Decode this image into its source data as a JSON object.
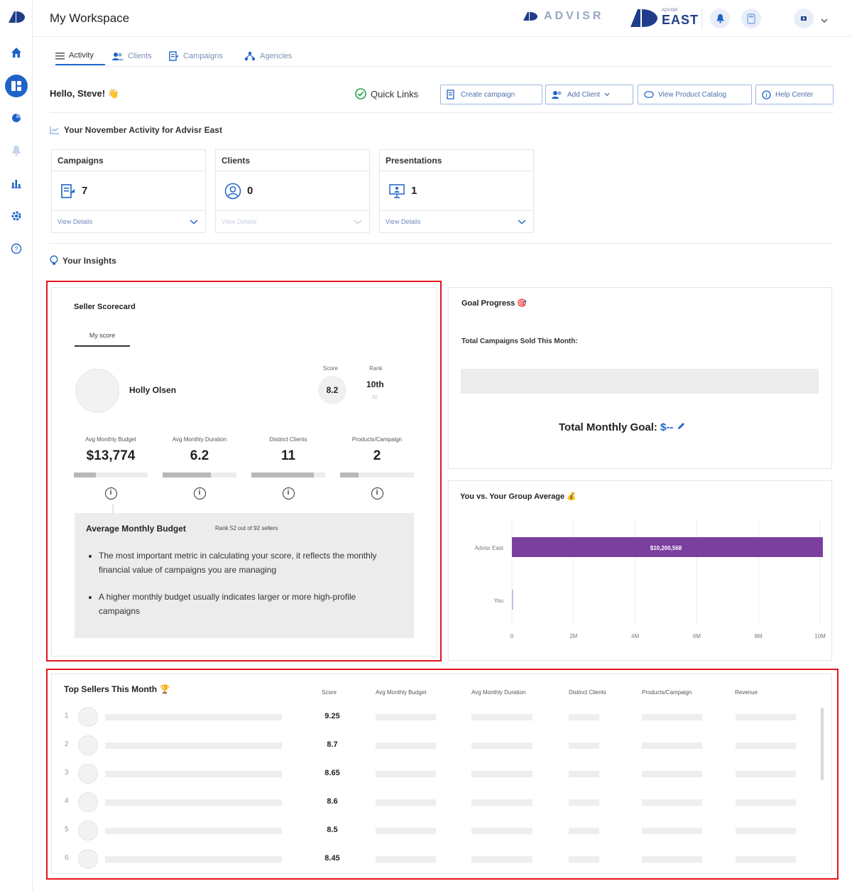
{
  "topbar": {
    "title": "My Workspace",
    "brand_primary": "ADVISR",
    "brand_secondary_small": "ADVISR",
    "brand_secondary": "EAST"
  },
  "sidebar": {
    "icons": [
      "logo-icon",
      "home-icon",
      "dashboard-icon",
      "pie-chart-icon",
      "bell-icon",
      "bar-chart-icon",
      "gear-icon",
      "help-icon"
    ]
  },
  "tabs": [
    {
      "label": "Activity",
      "active": true
    },
    {
      "label": "Clients",
      "active": false
    },
    {
      "label": "Campaigns",
      "active": false
    },
    {
      "label": "Agencies",
      "active": false
    }
  ],
  "greeting": "Hello, Steve! 👋",
  "quick_links": {
    "label": "Quick Links",
    "buttons": [
      "Create campaign",
      "Add Client",
      "View Product Catalog",
      "Help Center"
    ]
  },
  "activity": {
    "title": "Your November Activity for Advisr East",
    "cards": [
      {
        "title": "Campaigns",
        "value": "7",
        "link": "View Details",
        "enabled": true
      },
      {
        "title": "Clients",
        "value": "0",
        "link": "View Details",
        "enabled": false
      },
      {
        "title": "Presentations",
        "value": "1",
        "link": "View Details",
        "enabled": true
      }
    ]
  },
  "insights": {
    "title": "Your Insights"
  },
  "scorecard": {
    "title": "Seller Scorecard",
    "tab": "My score",
    "seller": "Holly Olsen",
    "score_label": "Score",
    "score": "8.2",
    "rank_label": "Rank",
    "rank": "10th",
    "rank_of": "92",
    "metrics": [
      {
        "label": "Avg Monthly Budget",
        "value": "$13,774",
        "fill": 0.3
      },
      {
        "label": "Avg Monthly Duration",
        "value": "6.2",
        "fill": 0.65
      },
      {
        "label": "Distinct Clients",
        "value": "11",
        "fill": 0.85
      },
      {
        "label": "Products/Campaign",
        "value": "2",
        "fill": 0.25
      }
    ],
    "detail": {
      "title": "Average Monthly Budget",
      "rank_text": "Rank 52 out of 92 sellers",
      "bullets": [
        "The most important metric in calculating your score, it reflects the monthly financial value of campaigns you are managing",
        "A higher monthly budget usually indicates larger or more high-profile campaigns"
      ]
    }
  },
  "goal": {
    "title": "Goal Progress 🎯",
    "subtitle": "Total Campaigns Sold This Month:",
    "total_label": "Total Monthly Goal:",
    "total_value": "$--"
  },
  "comparison": {
    "title": "You vs. Your Group Average 💰"
  },
  "chart_data": {
    "type": "bar",
    "orientation": "horizontal",
    "categories": [
      "Advisr East",
      "You"
    ],
    "values": [
      10200568,
      13774
    ],
    "data_labels": [
      "$10,200,568",
      ""
    ],
    "xticks": [
      "0",
      "2M",
      "4M",
      "6M",
      "8M",
      "10M"
    ],
    "xlim": [
      0,
      10000000
    ],
    "color": "#7b3fa0",
    "grid": true
  },
  "top_sellers": {
    "title": "Top Sellers This Month 🏆",
    "columns": [
      "Score",
      "Avg Monthly Budget",
      "Avg Monthly Duration",
      "Distinct Clients",
      "Products/Campaign",
      "Revenue"
    ],
    "rows": [
      {
        "rank": "1",
        "score": "9.25"
      },
      {
        "rank": "2",
        "score": "8.7"
      },
      {
        "rank": "3",
        "score": "8.65"
      },
      {
        "rank": "4",
        "score": "8.6"
      },
      {
        "rank": "5",
        "score": "8.5"
      },
      {
        "rank": "6",
        "score": "8.45"
      }
    ]
  },
  "colors": {
    "accent": "#1e64c8",
    "highlight": "#e3141b",
    "bar": "#7b3fa0"
  }
}
